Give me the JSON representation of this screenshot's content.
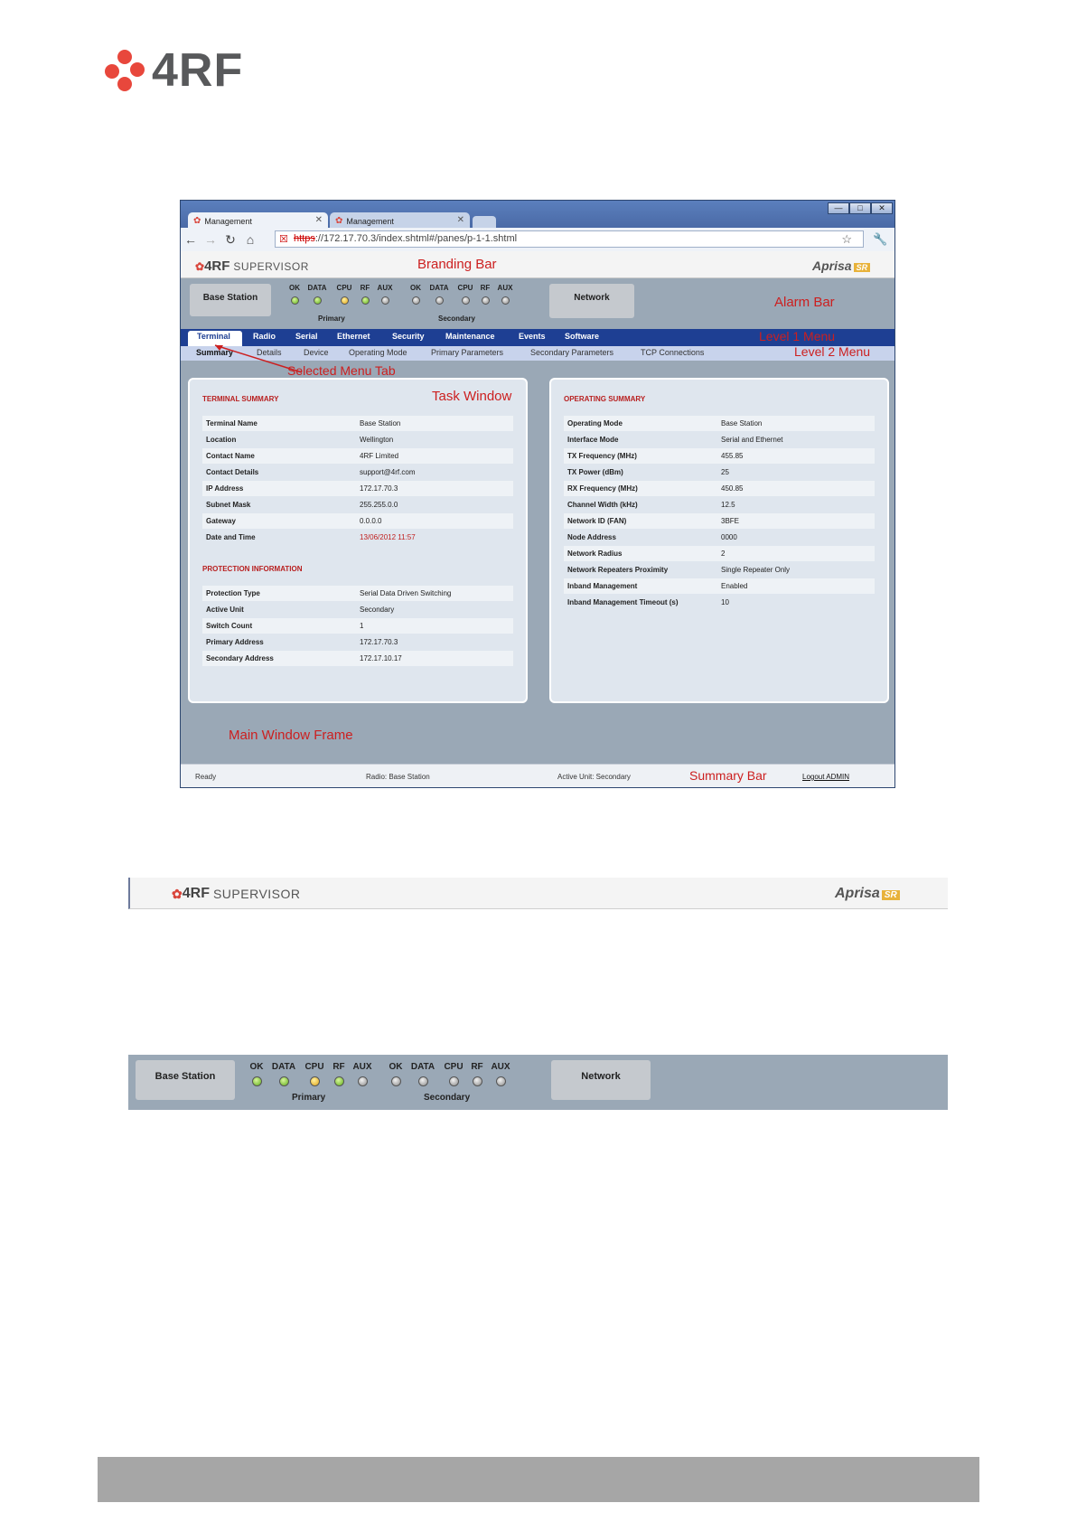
{
  "doc_logo": {
    "text": "4RF"
  },
  "browser": {
    "tabs": [
      {
        "label": "Management"
      },
      {
        "label": "Management"
      }
    ],
    "window_buttons": [
      "—",
      "□",
      "✕"
    ],
    "url_prefix": "https",
    "url_rest": "://172.17.70.3/index.shtml#/panes/p-1-1.shtml"
  },
  "app": {
    "brand": {
      "mark": "4RF",
      "product": "SUPERVISOR",
      "right_logo": "Aprisa",
      "right_badge": "SR"
    },
    "alarm": {
      "left_box": "Base Station",
      "right_box": "Network",
      "primary_label": "Primary",
      "secondary_label": "Secondary",
      "led_labels": [
        "OK",
        "DATA",
        "CPU",
        "RF",
        "AUX"
      ],
      "primary_leds": [
        "green",
        "green",
        "yellow",
        "green",
        "grey"
      ],
      "secondary_leds": [
        "grey",
        "grey",
        "grey",
        "grey",
        "grey"
      ]
    },
    "level1": [
      "Terminal",
      "Radio",
      "Serial",
      "Ethernet",
      "Security",
      "Maintenance",
      "Events",
      "Software"
    ],
    "level2": [
      "Summary",
      "Details",
      "Device",
      "Operating Mode",
      "Primary Parameters",
      "Secondary Parameters",
      "TCP Connections"
    ],
    "terminal_summary": {
      "title": "TERMINAL SUMMARY",
      "rows": [
        {
          "k": "Terminal Name",
          "v": "Base Station"
        },
        {
          "k": "Location",
          "v": "Wellington"
        },
        {
          "k": "Contact Name",
          "v": "4RF Limited"
        },
        {
          "k": "Contact Details",
          "v": "support@4rf.com"
        },
        {
          "k": "IP Address",
          "v": "172.17.70.3"
        },
        {
          "k": "Subnet Mask",
          "v": "255.255.0.0"
        },
        {
          "k": "Gateway",
          "v": "0.0.0.0"
        },
        {
          "k": "Date and Time",
          "v": "13/06/2012 11:57"
        }
      ]
    },
    "protection": {
      "title": "PROTECTION INFORMATION",
      "rows": [
        {
          "k": "Protection Type",
          "v": "Serial Data Driven Switching"
        },
        {
          "k": "Active Unit",
          "v": "Secondary"
        },
        {
          "k": "Switch Count",
          "v": "1"
        },
        {
          "k": "Primary Address",
          "v": "172.17.70.3"
        },
        {
          "k": "Secondary Address",
          "v": "172.17.10.17"
        }
      ]
    },
    "operating_summary": {
      "title": "OPERATING SUMMARY",
      "rows": [
        {
          "k": "Operating Mode",
          "v": "Base Station"
        },
        {
          "k": "Interface Mode",
          "v": "Serial and Ethernet"
        },
        {
          "k": "TX Frequency (MHz)",
          "v": "455.85"
        },
        {
          "k": "TX Power (dBm)",
          "v": "25"
        },
        {
          "k": "RX Frequency (MHz)",
          "v": "450.85"
        },
        {
          "k": "Channel Width (kHz)",
          "v": "12.5"
        },
        {
          "k": "Network ID (FAN)",
          "v": "3BFE"
        },
        {
          "k": "Node Address",
          "v": "0000"
        },
        {
          "k": "Network Radius",
          "v": "2"
        },
        {
          "k": "Network Repeaters Proximity",
          "v": "Single Repeater Only"
        },
        {
          "k": "Inband Management",
          "v": "Enabled"
        },
        {
          "k": "Inband Management Timeout (s)",
          "v": "10"
        }
      ]
    },
    "summary_bar": {
      "ready": "Ready",
      "radio": "Radio: Base Station",
      "active": "Active Unit: Secondary",
      "logout": "Logout ADMIN"
    }
  },
  "annotations": {
    "branding_bar": "Branding Bar",
    "alarm_bar": "Alarm Bar",
    "level1_menu": "Level 1 Menu",
    "level2_menu": "Level 2 Menu",
    "selected_tab": "Selected Menu Tab",
    "task_window": "Task Window",
    "main_frame": "Main Window Frame",
    "summary_bar": "Summary Bar"
  },
  "colors": {
    "accent_red": "#cc1f1f",
    "menu_blue": "#1e3f93",
    "alarm_grey": "#9aa8b6",
    "logo_red": "#e8473c"
  }
}
